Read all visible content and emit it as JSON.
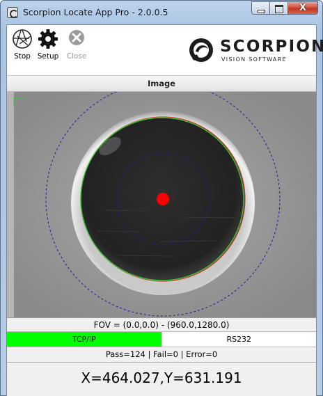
{
  "window": {
    "title": "Scorpion Locate App Pro - 2.0.0.5",
    "close_glyph": "X"
  },
  "toolbar": {
    "items": [
      {
        "label": "Stop",
        "icon": "aperture-icon",
        "enabled": true
      },
      {
        "label": "Setup",
        "icon": "gear-icon",
        "enabled": true
      },
      {
        "label": "Close",
        "icon": "close-circle-icon",
        "enabled": false
      }
    ]
  },
  "logo": {
    "word": "SCORPION",
    "tagline": "VISION SOFTWARE"
  },
  "image_panel": {
    "header": "Image"
  },
  "status": {
    "fov": "FOV = (0.0,0.0) - (960.0,1280.0)",
    "comm": [
      {
        "label": "TCP/IP",
        "active": true
      },
      {
        "label": "RS232",
        "active": false
      }
    ],
    "stats": "Pass=124 | Fail=0 | Error=0",
    "coordinates": "X=464.027,Y=631.191"
  },
  "colors": {
    "active_comm": "#00ff00",
    "target_dot": "#ff0000",
    "search_circle": "#1a1aa0",
    "fit_edge": "#33cc33"
  }
}
